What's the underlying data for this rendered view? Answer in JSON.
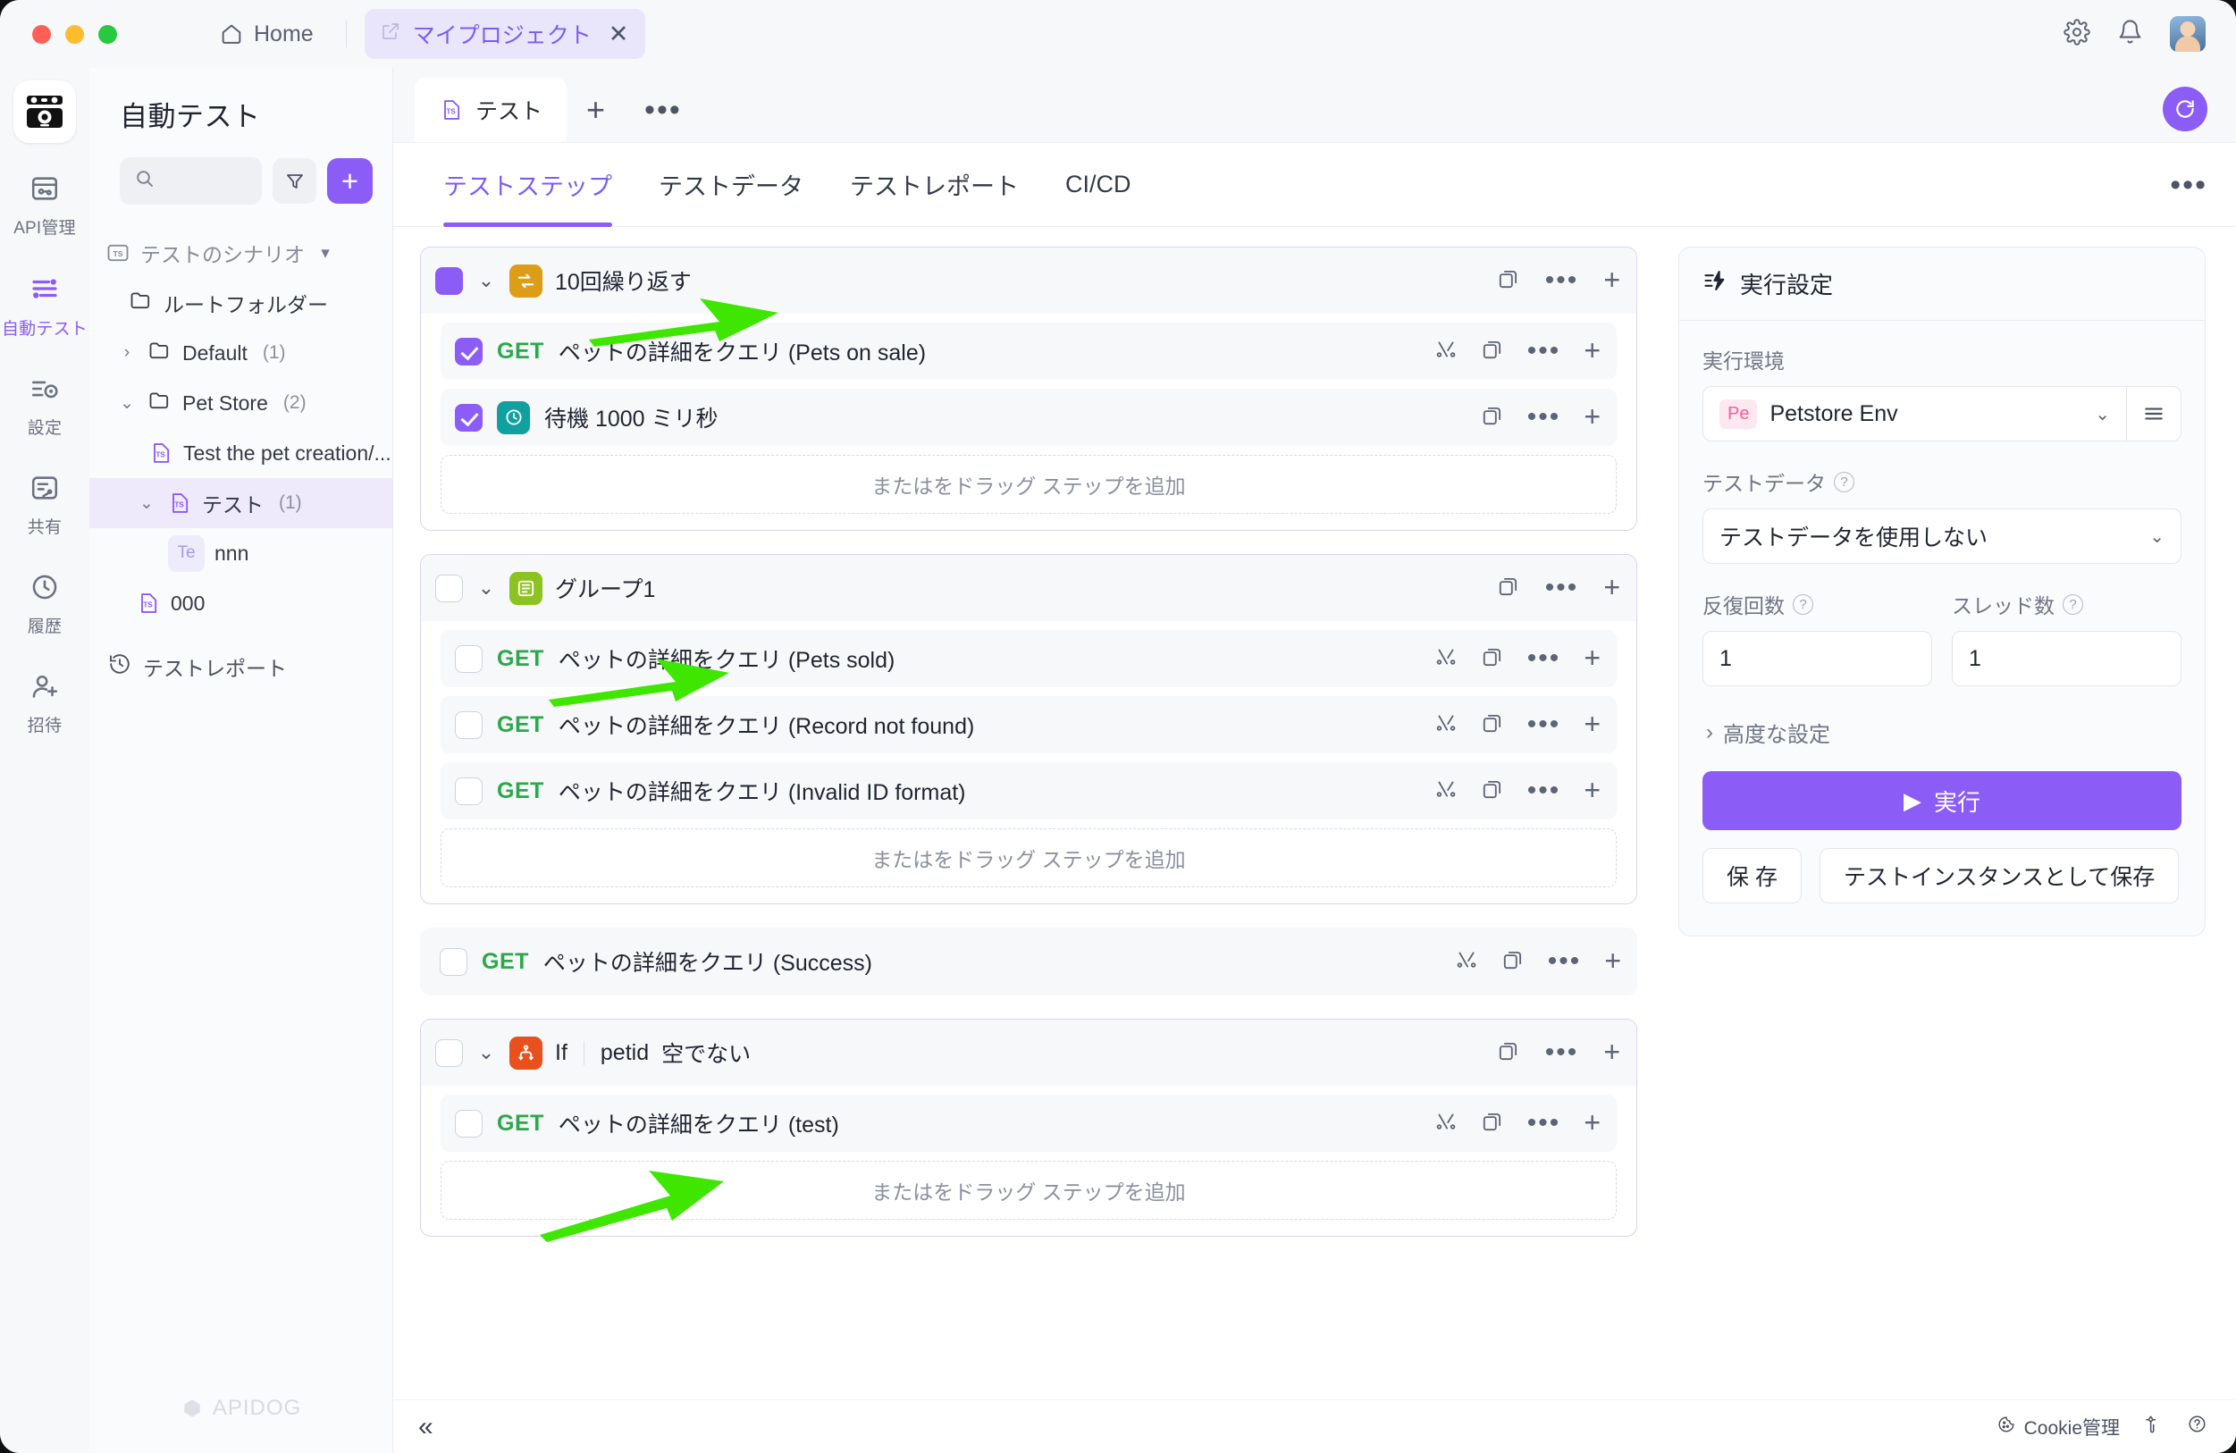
{
  "titlebar": {
    "home_label": "Home",
    "project_tab": "マイプロジェクト",
    "close_glyph": "✕"
  },
  "rail": {
    "items": [
      {
        "label": "API管理",
        "icon": "api-icon",
        "active": false
      },
      {
        "label": "自動テスト",
        "icon": "automated-test-icon",
        "active": true
      },
      {
        "label": "設定",
        "icon": "settings-icon",
        "active": false
      },
      {
        "label": "共有",
        "icon": "share-icon",
        "active": false
      },
      {
        "label": "履歴",
        "icon": "history-icon",
        "active": false
      },
      {
        "label": "招待",
        "icon": "invite-icon",
        "active": false
      }
    ]
  },
  "sidebar": {
    "title": "自動テスト",
    "search_placeholder": "",
    "search_value": "",
    "tree": [
      {
        "label": "テストのシナリオ",
        "count": "",
        "icon": "ts-folder-icon",
        "caret": "▾",
        "indent": 0,
        "muted": true,
        "selected": false
      },
      {
        "label": "ルートフォルダー",
        "count": "",
        "icon": "folder-icon",
        "caret": "",
        "indent": 1,
        "muted": false,
        "selected": false
      },
      {
        "label": "Default",
        "count": "(1)",
        "icon": "folder-icon",
        "caret": "›",
        "indent": 2,
        "muted": false,
        "selected": false
      },
      {
        "label": "Pet Store",
        "count": "(2)",
        "icon": "folder-icon",
        "caret": "⌄",
        "indent": 2,
        "muted": false,
        "selected": false
      },
      {
        "label": "Test the pet creation/...",
        "count": "",
        "icon": "ts-file-icon",
        "caret": "",
        "indent": 3,
        "muted": false,
        "selected": false
      },
      {
        "label": "テスト",
        "count": "(1)",
        "icon": "ts-file-icon",
        "caret": "⌄",
        "indent": 3,
        "muted": false,
        "selected": true
      },
      {
        "label": "nnn",
        "count": "",
        "icon": "te-chip",
        "chip": "Te",
        "caret": "",
        "indent": 4,
        "muted": false,
        "selected": false
      },
      {
        "label": "000",
        "count": "",
        "icon": "ts-file-icon",
        "caret": "",
        "indent": 3,
        "muted": false,
        "selected": false
      }
    ],
    "report_label": "テストレポート",
    "watermark": "APIDOG"
  },
  "doc_tabs": {
    "tabs": [
      {
        "label": "テスト",
        "icon": "ts-file-icon",
        "active": true
      }
    ],
    "plus_glyph": "+",
    "dots_glyph": "•••"
  },
  "subtabs": {
    "items": [
      {
        "label": "テストステップ",
        "active": true
      },
      {
        "label": "テストデータ",
        "active": false
      },
      {
        "label": "テストレポート",
        "active": false
      },
      {
        "label": "CI/CD",
        "active": false
      }
    ],
    "more_glyph": "•••"
  },
  "steps": {
    "add_step_placeholder": "またはをドラッグ ステップを追加",
    "blocks": [
      {
        "kind": "block",
        "type": "loop",
        "icon": "loop-icon",
        "title": "10回繰り返す",
        "checkbox": "half",
        "caret": "⌄",
        "children": [
          {
            "checkbox": "on",
            "method": "GET",
            "name": "ペットの詳細をクエリ (Pets on sale)",
            "icon": ""
          },
          {
            "checkbox": "on",
            "method": "",
            "name": "待機 1000 ミリ秒",
            "icon": "wait-icon"
          }
        ]
      },
      {
        "kind": "block",
        "type": "group",
        "icon": "group-icon",
        "title": "グループ1",
        "checkbox": "off",
        "caret": "⌄",
        "children": [
          {
            "checkbox": "off",
            "method": "GET",
            "name": "ペットの詳細をクエリ (Pets sold)",
            "icon": ""
          },
          {
            "checkbox": "off",
            "method": "GET",
            "name": "ペットの詳細をクエリ (Record not found)",
            "icon": ""
          },
          {
            "checkbox": "off",
            "method": "GET",
            "name": "ペットの詳細をクエリ (Invalid ID format)",
            "icon": ""
          }
        ]
      },
      {
        "kind": "standalone",
        "checkbox": "off",
        "method": "GET",
        "name": "ペットの詳細をクエリ (Success)"
      },
      {
        "kind": "block",
        "type": "if",
        "icon": "if-icon",
        "title": "If",
        "condition_var": "petid",
        "condition_op": "空でない",
        "checkbox": "off",
        "caret": "⌄",
        "children": [
          {
            "checkbox": "off",
            "method": "GET",
            "name": "ペットの詳細をクエリ (test)",
            "icon": ""
          }
        ]
      }
    ]
  },
  "run_panel": {
    "heading": "実行設定",
    "env_label": "実行環境",
    "env_chip": "Pe",
    "env_value": "Petstore Env",
    "testdata_label": "テストデータ",
    "testdata_value": "テストデータを使用しない",
    "iterations_label": "反復回数",
    "iterations_value": "1",
    "threads_label": "スレッド数",
    "threads_value": "1",
    "advanced_label": "高度な設定",
    "run_label": "実行",
    "run_glyph": "▶",
    "save_label": "保 存",
    "save_instance_label": "テストインスタンスとして保存"
  },
  "statusbar": {
    "collapse_glyph": "«",
    "cookie_label": "Cookie管理",
    "wrench_icon": "wrench-icon",
    "help_icon": "help-icon"
  },
  "colors": {
    "accent": "#8b5cf6",
    "get_method": "#2aa84a",
    "loop": "#dd9d17",
    "group": "#8dc320",
    "if": "#e8501d",
    "wait": "#11a0a0",
    "arrow": "#3ee600"
  }
}
